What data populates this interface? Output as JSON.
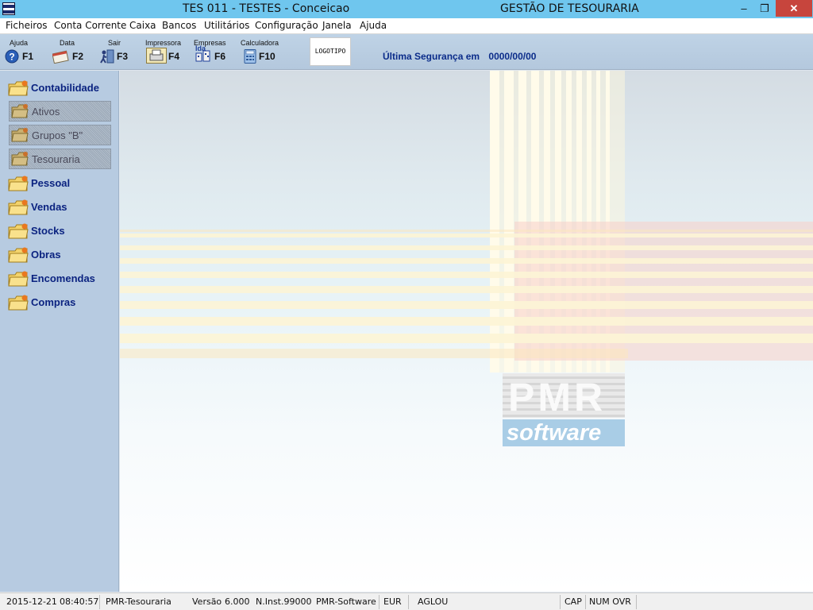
{
  "window": {
    "title_left": "TES 011 - TESTES - Conceicao",
    "title_right": "GESTÃO DE TESOURARIA",
    "minimize_glyph": "–",
    "restore_glyph": "❐",
    "close_glyph": "✕"
  },
  "menu": [
    "Ficheiros",
    "Conta Corrente",
    "Caixa",
    "Bancos",
    "Utilitários",
    "Configuração",
    "Janela",
    "Ajuda"
  ],
  "toolbar": {
    "buttons": [
      {
        "caption": "Ajuda",
        "key": "F1",
        "icon": "help-icon"
      },
      {
        "caption": "Data",
        "key": "F2",
        "icon": "calendar-icon"
      },
      {
        "caption": "Sair",
        "key": "F3",
        "icon": "exit-icon"
      },
      {
        "caption": "Impressora",
        "key": "F4",
        "icon": "printer-icon"
      },
      {
        "caption": "Empresas",
        "key": "F6",
        "icon": "companies-icon",
        "icon_text": "lda"
      },
      {
        "caption": "Calculadora",
        "key": "F10",
        "icon": "calculator-icon"
      }
    ],
    "logo_text": "LOGOTIPO",
    "security_label": "Última Segurança em",
    "security_date": "0000/00/00"
  },
  "sidebar": {
    "items": [
      {
        "label": "Contabilidade",
        "type": "main",
        "icon": "folder-icon"
      },
      {
        "label": "Ativos",
        "type": "sub",
        "icon": "folder-icon"
      },
      {
        "label": "Grupos \"B\"",
        "type": "sub",
        "icon": "folder-icon"
      },
      {
        "label": "Tesouraria",
        "type": "sub",
        "icon": "folder-icon"
      },
      {
        "label": "Pessoal",
        "type": "main",
        "icon": "folder-icon"
      },
      {
        "label": "Vendas",
        "type": "main",
        "icon": "folder-icon"
      },
      {
        "label": "Stocks",
        "type": "main",
        "icon": "folder-icon"
      },
      {
        "label": "Obras",
        "type": "main",
        "icon": "folder-icon"
      },
      {
        "label": "Encomendas",
        "type": "main",
        "icon": "folder-icon"
      },
      {
        "label": "Compras",
        "type": "main",
        "icon": "folder-icon"
      }
    ]
  },
  "watermark": {
    "brand_top": "PMR",
    "brand_bottom": "software"
  },
  "status": {
    "date": "2015-12-21",
    "time": "08:40:57",
    "app": "PMR-Tesouraria",
    "version_label": "Versão",
    "version": "6.000",
    "inst": "N.Inst.99000",
    "vendor": "PMR-Software",
    "currency": "EUR",
    "user": "AGLOU",
    "cap": "CAP",
    "num_ovr": "NUM OVR"
  },
  "colors": {
    "title_bar": "#6fc6ee",
    "sidebar": "#b7cbe1",
    "accent_text": "#0b2380",
    "close_button": "#c7453d"
  }
}
